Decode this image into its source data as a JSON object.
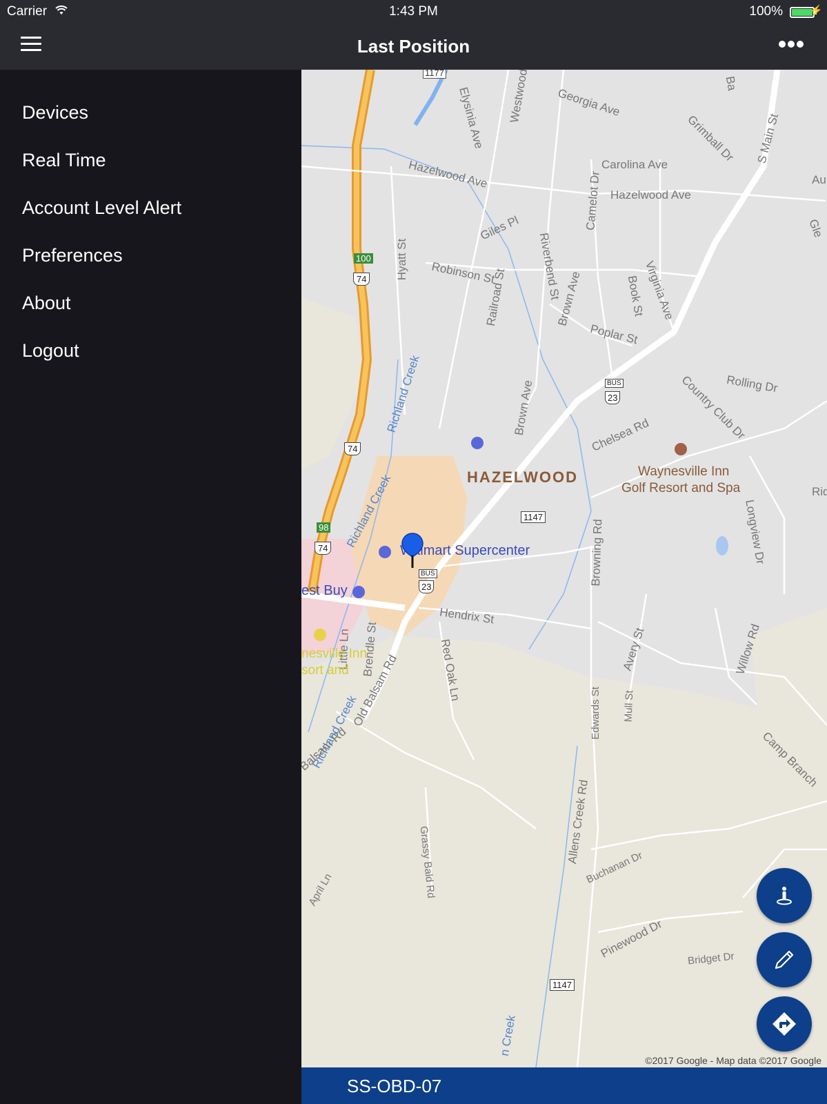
{
  "status_bar": {
    "carrier": "Carrier",
    "time": "1:43 PM",
    "battery_percent": "100%",
    "battery_level": 1.0
  },
  "nav_bar": {
    "title": "Last Position",
    "menu_icon": "hamburger-menu-icon",
    "more_icon": "more-options-icon"
  },
  "drawer": {
    "items": [
      {
        "label": "Devices"
      },
      {
        "label": "Real Time"
      },
      {
        "label": "Account Level Alert"
      },
      {
        "label": "Preferences"
      },
      {
        "label": "About"
      },
      {
        "label": "Logout"
      }
    ]
  },
  "map": {
    "streets": {
      "georgia": "Georgia Ave",
      "carolina": "Carolina Ave",
      "hazelwood1": "Hazelwood Ave",
      "hazelwood2": "Hazelwood Ave",
      "elysinia": "Elysinia Ave",
      "westwood": "Westwood",
      "grimball": "Grimball Dr",
      "smain": "S Main St",
      "camelot": "Camelot Dr",
      "giles": "Giles Pl",
      "riverbend": "Riverbend St",
      "robinson": "Robinson St",
      "railroad": "Railroad St",
      "hyatt": "Hyatt St",
      "brown1": "Brown Ave",
      "brown2": "Brown Ave",
      "book": "Book St",
      "virginia": "Virginia Ave",
      "poplar": "Poplar St",
      "rolling": "Rolling Dr",
      "countryclub": "Country Club Dr",
      "chelsea": "Chelsea Rd",
      "richland1": "Richland Creek",
      "richland2": "Richland Creek",
      "richland3": "Richland Creek",
      "browning": "Browning Rd",
      "longview": "Longview Dr",
      "hendrix": "Hendrix St",
      "redoak": "Red Oak Ln",
      "little": "Little Ln",
      "brendle": "Brendle St",
      "oldbalsam": "Old Balsam Rd",
      "balsam": "Balsam Rd",
      "avery": "Avery St",
      "willow": "Willow Rd",
      "edwards": "Edwards St",
      "mull": "Mull St",
      "campbranch": "Camp Branch",
      "allenscreek": "Allens Creek Rd",
      "grassybald": "Grassy Bald Rd",
      "april": "April Ln",
      "buchanan": "Buchanan Dr",
      "pinewood": "Pinewood Dr",
      "bridget": "Bridget Dr",
      "creek": "n Creek",
      "ridge": "Rid",
      "glen": "Gle",
      "au": "Au",
      "ba": "Ba"
    },
    "place_hazelwood": "HAZELWOOD",
    "inn_line1": "Waynesville Inn",
    "inn_line2": "Golf Resort and Spa",
    "walmart": "Walmart Supercenter",
    "bestbuy": "est Buy",
    "resort_line1": "nesville Inn",
    "resort_line2": "sort and",
    "shields": {
      "s1177": "1177",
      "s100": "100",
      "s74a": "74",
      "s74b": "74",
      "s74c": "74",
      "s98": "98",
      "sbus1": "BUS",
      "s23a": "23",
      "sbus2": "BUS",
      "s23b": "23",
      "s1147a": "1147",
      "s1147b": "1147"
    },
    "copyright": "©2017 Google - Map data ©2017 Google"
  },
  "fabs": [
    {
      "icon": "person-pin-icon"
    },
    {
      "icon": "pencil-icon"
    },
    {
      "icon": "directions-icon"
    }
  ],
  "bottom_bar": {
    "device_name": "SS-OBD-07"
  },
  "colors": {
    "header": "#2a2b30",
    "drawer": "#16161c",
    "accent": "#0d3f8a",
    "highway": "#f5b547",
    "map_bg": "#e3e3e3"
  }
}
